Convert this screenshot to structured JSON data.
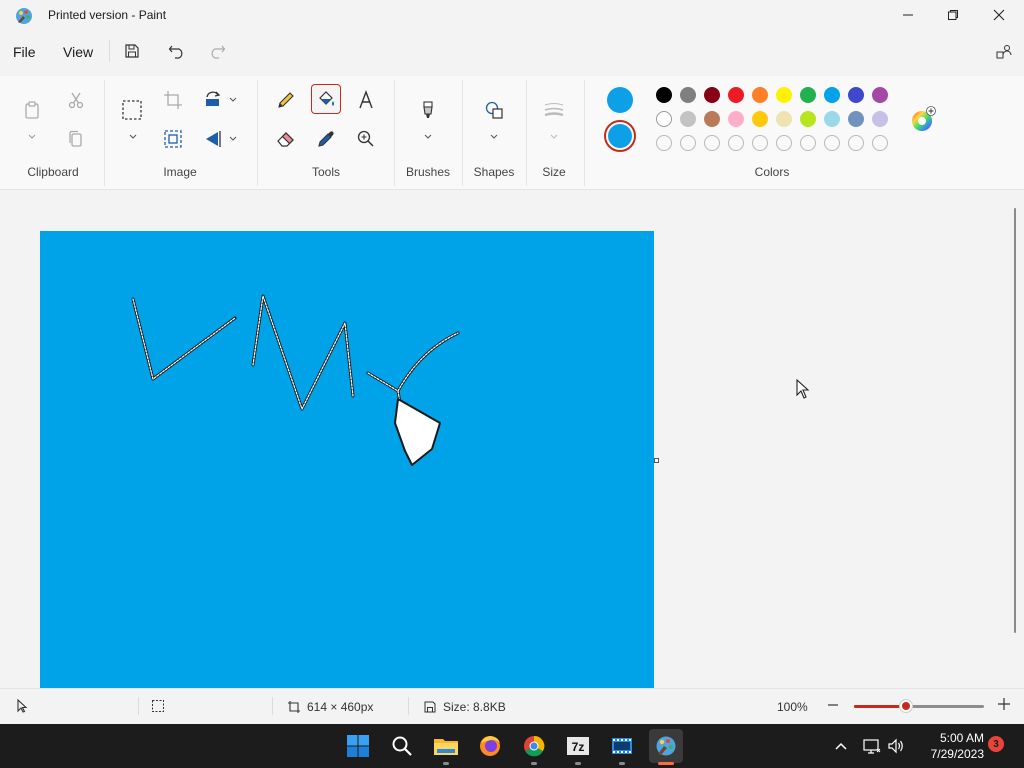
{
  "window": {
    "title": "Printed version - Paint",
    "icon": "paint-palette-icon"
  },
  "menu": {
    "file_label": "File",
    "view_label": "View",
    "quick_actions": [
      "save-icon",
      "undo-icon",
      "redo-icon"
    ]
  },
  "ribbon": {
    "groups": {
      "clipboard": "Clipboard",
      "image": "Image",
      "tools": "Tools",
      "brushes": "Brushes",
      "shapes": "Shapes",
      "size": "Size",
      "colors": "Colors"
    },
    "selected_tool": "fill-icon"
  },
  "colors": {
    "color1": "#0ea0e6",
    "color2": "#0ea0e6",
    "accent": "#c42b1c",
    "palette_row1": [
      "#000000",
      "#7f7f7f",
      "#880015",
      "#ed1c24",
      "#ff7f27",
      "#fff200",
      "#22b14c",
      "#00a2e8",
      "#3f48cc",
      "#a349a4"
    ],
    "palette_row2": [
      "#ffffff",
      "#c3c3c3",
      "#b97a57",
      "#ffaec9",
      "#ffc90e",
      "#efe4b0",
      "#b5e61d",
      "#99d9ea",
      "#7092be",
      "#c8bfe7"
    ],
    "palette_row3_custom_empty": 10
  },
  "canvas": {
    "fill_color": "#00a2e8"
  },
  "status": {
    "dimensions": "614 × 460px",
    "size": "Size: 8.8KB",
    "zoom": "100%",
    "zoom_level_fraction": 0.4
  },
  "taskbar": {
    "apps": [
      "windows-start-icon",
      "search-icon",
      "file-explorer-icon",
      "firefox-icon",
      "chrome-icon",
      "7zip-icon",
      "video-editor-icon",
      "paint-icon"
    ],
    "time": "5:00 AM",
    "date": "7/29/2023",
    "notification_count": "3"
  }
}
